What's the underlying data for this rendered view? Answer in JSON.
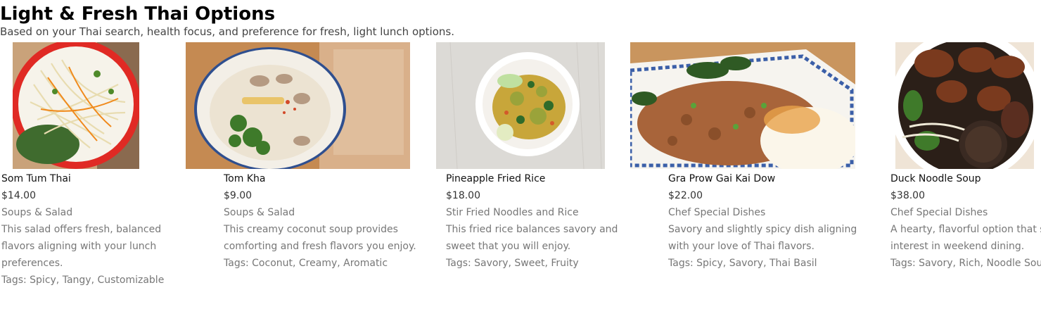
{
  "header": {
    "title": "Light & Fresh Thai Options",
    "subtitle": "Based on your Thai search, health focus, and preference for fresh, light lunch options."
  },
  "dishes": [
    {
      "name": "Som Tum Thai",
      "price": "$14.00",
      "category": "Soups & Salad",
      "description": "This salad offers fresh, balanced flavors aligning with your lunch preferences.",
      "tags": "Tags: Spicy, Tangy, Customizable"
    },
    {
      "name": "Tom Kha",
      "price": "$9.00",
      "category": "Soups & Salad",
      "description": "This creamy coconut soup provides comforting and fresh flavors you enjoy.",
      "tags": "Tags: Coconut, Creamy, Aromatic"
    },
    {
      "name": "Pineapple Fried Rice",
      "price": "$18.00",
      "category": "Stir Fried Noodles and Rice",
      "description": "This fried rice balances savory and sweet that you will enjoy.",
      "tags": "Tags: Savory, Sweet, Fruity"
    },
    {
      "name": "Gra Prow Gai Kai Dow",
      "price": "$22.00",
      "category": "Chef Special Dishes",
      "description": "Savory and slightly spicy dish aligning with your love of Thai flavors.",
      "tags": "Tags: Spicy, Savory, Thai Basil"
    },
    {
      "name": "Duck Noodle Soup",
      "price": "$38.00",
      "category": "Chef Special Dishes",
      "description": "A hearty, flavorful option that suits your interest in weekend dining.",
      "tags": "Tags: Savory, Rich, Noodle Soup"
    }
  ]
}
